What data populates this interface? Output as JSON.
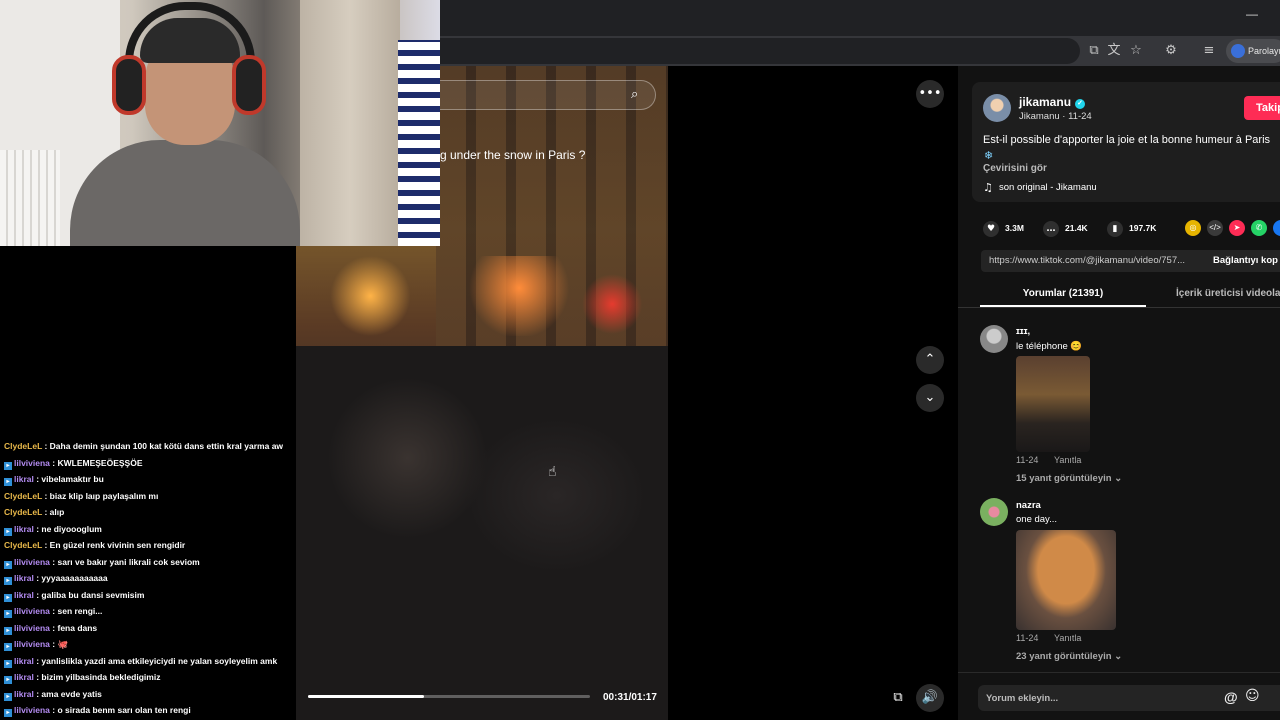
{
  "browser": {
    "profile_label": "Parolayı",
    "minimize_icon": "minimize-icon",
    "toolbar_icons": [
      "install-icon",
      "translate-icon",
      "star-icon",
      "extensions-icon",
      "reading-list-icon"
    ]
  },
  "video": {
    "caption": "g under the snow in Paris ?",
    "time": "00:31/01:17",
    "progress": 0.41
  },
  "author": {
    "name": "jikamanu",
    "meta": "Jikamanu · 11-24",
    "follow_label": "Takip"
  },
  "post": {
    "description": "Est-il possible d'apporter la joie et la bonne humeur à Paris",
    "translate_label": "Çevirisini gör",
    "music": "son original - Jikamanu"
  },
  "stats": {
    "likes": "3.3M",
    "comments": "21.4K",
    "saves": "197.7K"
  },
  "share": {
    "url": "https://www.tiktok.com/@jikamanu/video/757...",
    "copy_label": "Bağlantıyı kop"
  },
  "tabs": {
    "comments": "Yorumlar (21391)",
    "creator": "İçerik üreticisi videoları"
  },
  "comments": [
    {
      "user": "ɪɪɪ,",
      "text": "le téléphone 😊",
      "date": "11-24",
      "reply": "Yanıtla",
      "replies": "15 yanıt görüntüleyin"
    },
    {
      "user": "nazra",
      "text": "one day...",
      "date": "11-24",
      "reply": "Yanıtla",
      "replies": "23 yanıt görüntüleyin"
    }
  ],
  "comment_input": {
    "placeholder": "Yorum ekleyin..."
  },
  "chat": [
    {
      "user": "ClydeLeL",
      "msg": "Daha demin şundan 100 kat kötü dans ettin kral yarma aw",
      "color": "#e8b84a",
      "badge": false
    },
    {
      "user": "lilviviena",
      "msg": "KWLEMEŞEÖEŞŞÖE",
      "color": "#b48cf2",
      "badge": true
    },
    {
      "user": "likral",
      "msg": "vibelamaktır bu",
      "color": "#b48cf2",
      "badge": true
    },
    {
      "user": "ClydeLeL",
      "msg": "biaz klip laıp paylaşalım mı",
      "color": "#e8b84a",
      "badge": false
    },
    {
      "user": "ClydeLeL",
      "msg": "alıp",
      "color": "#e8b84a",
      "badge": false
    },
    {
      "user": "likral",
      "msg": "ne diyoooglum",
      "color": "#b48cf2",
      "badge": true
    },
    {
      "user": "ClydeLeL",
      "msg": "En güzel renk vivinin sen rengidir",
      "color": "#e8b84a",
      "badge": false
    },
    {
      "user": "lilviviena",
      "msg": "sarı ve bakır yani likrali cok seviom",
      "color": "#b48cf2",
      "badge": true
    },
    {
      "user": "likral",
      "msg": "yyyaaaaaaaaaaa",
      "color": "#b48cf2",
      "badge": true
    },
    {
      "user": "likral",
      "msg": "galiba bu dansi sevmisim",
      "color": "#b48cf2",
      "badge": true
    },
    {
      "user": "lilviviena",
      "msg": "sen rengi...",
      "color": "#b48cf2",
      "badge": true
    },
    {
      "user": "lilviviena",
      "msg": "fena dans",
      "color": "#b48cf2",
      "badge": true
    },
    {
      "user": "lilviviena",
      "msg": "🐙",
      "color": "#b48cf2",
      "badge": true
    },
    {
      "user": "likral",
      "msg": "yanlislikla yazdi ama etkileyiciydi ne yalan soyleyelim amk",
      "color": "#b48cf2",
      "badge": true
    },
    {
      "user": "likral",
      "msg": "bizim yilbasinda bekledigimiz",
      "color": "#b48cf2",
      "badge": true
    },
    {
      "user": "likral",
      "msg": "ama evde yatis",
      "color": "#b48cf2",
      "badge": true
    },
    {
      "user": "lilviviena",
      "msg": "o sirada benm sarı olan ten rengi",
      "color": "#b48cf2",
      "badge": true
    }
  ]
}
